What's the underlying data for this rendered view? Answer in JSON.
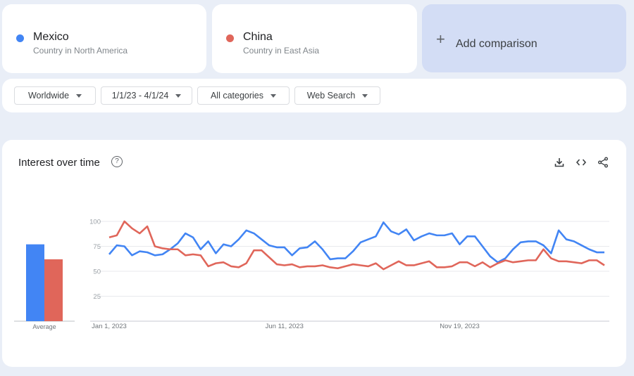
{
  "terms": [
    {
      "name": "Mexico",
      "description": "Country in North America",
      "color": "#4285f4"
    },
    {
      "name": "China",
      "description": "Country in East Asia",
      "color": "#e0665a"
    }
  ],
  "add_comparison": {
    "icon": "plus-icon",
    "label": "Add comparison"
  },
  "filters": {
    "region": "Worldwide",
    "date_range": "1/1/23 - 4/1/24",
    "category": "All categories",
    "search_type": "Web Search"
  },
  "panel": {
    "title": "Interest over time",
    "help_icon": "?",
    "icons": [
      "download-icon",
      "embed-icon",
      "share-icon"
    ]
  },
  "chart_data": {
    "type": "line",
    "title": "Interest over time",
    "ylim": [
      0,
      100
    ],
    "yticks": [
      100,
      75,
      50,
      25
    ],
    "xtick_labels": [
      "Jan 1, 2023",
      "Jun 11, 2023",
      "Nov 19, 2023"
    ],
    "xtick_indices": [
      0,
      23,
      46
    ],
    "average_label": "Average",
    "averages": [
      77,
      62
    ],
    "series": [
      {
        "name": "Mexico",
        "color": "#4285f4",
        "values": [
          67,
          76,
          75,
          66,
          70,
          69,
          66,
          67,
          72,
          78,
          88,
          84,
          72,
          80,
          68,
          77,
          75,
          82,
          91,
          88,
          82,
          76,
          74,
          74,
          66,
          73,
          74,
          80,
          72,
          62,
          63,
          63,
          70,
          79,
          82,
          85,
          99,
          90,
          87,
          92,
          81,
          85,
          88,
          86,
          86,
          88,
          77,
          85,
          85,
          75,
          65,
          59,
          63,
          72,
          79,
          80,
          80,
          76,
          68,
          91,
          82,
          80,
          76,
          72,
          69,
          69
        ]
      },
      {
        "name": "China",
        "color": "#e0665a",
        "values": [
          84,
          86,
          100,
          93,
          88,
          95,
          75,
          73,
          72,
          72,
          66,
          67,
          66,
          55,
          58,
          59,
          55,
          54,
          58,
          71,
          71,
          64,
          57,
          56,
          57,
          54,
          55,
          55,
          56,
          54,
          53,
          55,
          57,
          56,
          55,
          58,
          52,
          56,
          60,
          56,
          56,
          58,
          60,
          54,
          54,
          55,
          59,
          59,
          55,
          59,
          54,
          58,
          61,
          59,
          60,
          61,
          61,
          72,
          63,
          60,
          60,
          59,
          58,
          61,
          61,
          56
        ]
      }
    ]
  }
}
